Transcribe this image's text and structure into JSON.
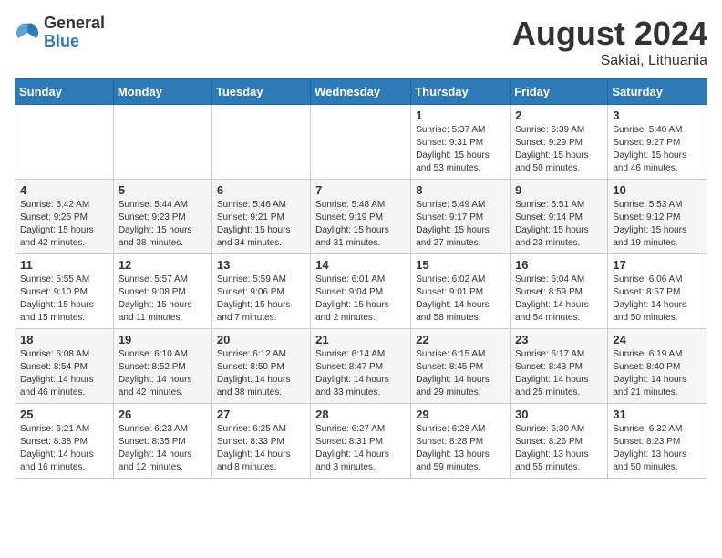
{
  "logo": {
    "general": "General",
    "blue": "Blue"
  },
  "title": "August 2024",
  "location": "Sakiai, Lithuania",
  "days_of_week": [
    "Sunday",
    "Monday",
    "Tuesday",
    "Wednesday",
    "Thursday",
    "Friday",
    "Saturday"
  ],
  "weeks": [
    [
      {
        "day": "",
        "info": ""
      },
      {
        "day": "",
        "info": ""
      },
      {
        "day": "",
        "info": ""
      },
      {
        "day": "",
        "info": ""
      },
      {
        "day": "1",
        "info": "Sunrise: 5:37 AM\nSunset: 9:31 PM\nDaylight: 15 hours\nand 53 minutes."
      },
      {
        "day": "2",
        "info": "Sunrise: 5:39 AM\nSunset: 9:29 PM\nDaylight: 15 hours\nand 50 minutes."
      },
      {
        "day": "3",
        "info": "Sunrise: 5:40 AM\nSunset: 9:27 PM\nDaylight: 15 hours\nand 46 minutes."
      }
    ],
    [
      {
        "day": "4",
        "info": "Sunrise: 5:42 AM\nSunset: 9:25 PM\nDaylight: 15 hours\nand 42 minutes."
      },
      {
        "day": "5",
        "info": "Sunrise: 5:44 AM\nSunset: 9:23 PM\nDaylight: 15 hours\nand 38 minutes."
      },
      {
        "day": "6",
        "info": "Sunrise: 5:46 AM\nSunset: 9:21 PM\nDaylight: 15 hours\nand 34 minutes."
      },
      {
        "day": "7",
        "info": "Sunrise: 5:48 AM\nSunset: 9:19 PM\nDaylight: 15 hours\nand 31 minutes."
      },
      {
        "day": "8",
        "info": "Sunrise: 5:49 AM\nSunset: 9:17 PM\nDaylight: 15 hours\nand 27 minutes."
      },
      {
        "day": "9",
        "info": "Sunrise: 5:51 AM\nSunset: 9:14 PM\nDaylight: 15 hours\nand 23 minutes."
      },
      {
        "day": "10",
        "info": "Sunrise: 5:53 AM\nSunset: 9:12 PM\nDaylight: 15 hours\nand 19 minutes."
      }
    ],
    [
      {
        "day": "11",
        "info": "Sunrise: 5:55 AM\nSunset: 9:10 PM\nDaylight: 15 hours\nand 15 minutes."
      },
      {
        "day": "12",
        "info": "Sunrise: 5:57 AM\nSunset: 9:08 PM\nDaylight: 15 hours\nand 11 minutes."
      },
      {
        "day": "13",
        "info": "Sunrise: 5:59 AM\nSunset: 9:06 PM\nDaylight: 15 hours\nand 7 minutes."
      },
      {
        "day": "14",
        "info": "Sunrise: 6:01 AM\nSunset: 9:04 PM\nDaylight: 15 hours\nand 2 minutes."
      },
      {
        "day": "15",
        "info": "Sunrise: 6:02 AM\nSunset: 9:01 PM\nDaylight: 14 hours\nand 58 minutes."
      },
      {
        "day": "16",
        "info": "Sunrise: 6:04 AM\nSunset: 8:59 PM\nDaylight: 14 hours\nand 54 minutes."
      },
      {
        "day": "17",
        "info": "Sunrise: 6:06 AM\nSunset: 8:57 PM\nDaylight: 14 hours\nand 50 minutes."
      }
    ],
    [
      {
        "day": "18",
        "info": "Sunrise: 6:08 AM\nSunset: 8:54 PM\nDaylight: 14 hours\nand 46 minutes."
      },
      {
        "day": "19",
        "info": "Sunrise: 6:10 AM\nSunset: 8:52 PM\nDaylight: 14 hours\nand 42 minutes."
      },
      {
        "day": "20",
        "info": "Sunrise: 6:12 AM\nSunset: 8:50 PM\nDaylight: 14 hours\nand 38 minutes."
      },
      {
        "day": "21",
        "info": "Sunrise: 6:14 AM\nSunset: 8:47 PM\nDaylight: 14 hours\nand 33 minutes."
      },
      {
        "day": "22",
        "info": "Sunrise: 6:15 AM\nSunset: 8:45 PM\nDaylight: 14 hours\nand 29 minutes."
      },
      {
        "day": "23",
        "info": "Sunrise: 6:17 AM\nSunset: 8:43 PM\nDaylight: 14 hours\nand 25 minutes."
      },
      {
        "day": "24",
        "info": "Sunrise: 6:19 AM\nSunset: 8:40 PM\nDaylight: 14 hours\nand 21 minutes."
      }
    ],
    [
      {
        "day": "25",
        "info": "Sunrise: 6:21 AM\nSunset: 8:38 PM\nDaylight: 14 hours\nand 16 minutes."
      },
      {
        "day": "26",
        "info": "Sunrise: 6:23 AM\nSunset: 8:35 PM\nDaylight: 14 hours\nand 12 minutes."
      },
      {
        "day": "27",
        "info": "Sunrise: 6:25 AM\nSunset: 8:33 PM\nDaylight: 14 hours\nand 8 minutes."
      },
      {
        "day": "28",
        "info": "Sunrise: 6:27 AM\nSunset: 8:31 PM\nDaylight: 14 hours\nand 3 minutes."
      },
      {
        "day": "29",
        "info": "Sunrise: 6:28 AM\nSunset: 8:28 PM\nDaylight: 13 hours\nand 59 minutes."
      },
      {
        "day": "30",
        "info": "Sunrise: 6:30 AM\nSunset: 8:26 PM\nDaylight: 13 hours\nand 55 minutes."
      },
      {
        "day": "31",
        "info": "Sunrise: 6:32 AM\nSunset: 8:23 PM\nDaylight: 13 hours\nand 50 minutes."
      }
    ]
  ]
}
